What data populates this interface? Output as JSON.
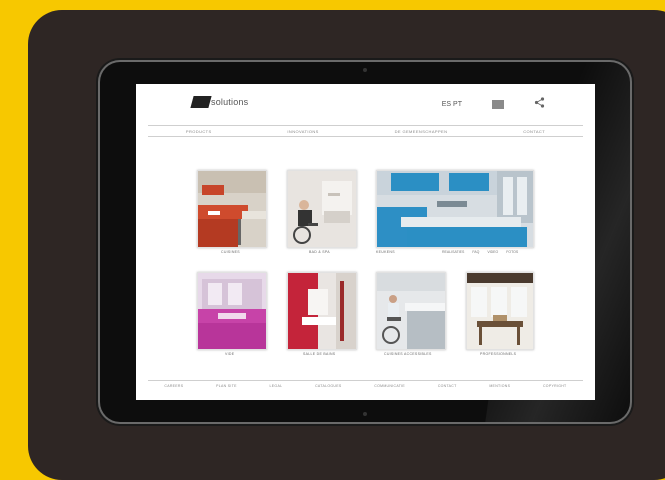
{
  "app": {
    "logo_text": "solutions",
    "header_icons": [
      "language-icon",
      "menu-icon",
      "share-icon"
    ],
    "language_label": "ES PT",
    "colors": {
      "background": "#f7c800",
      "panel": "#2e2624",
      "screen": "#ffffff",
      "blue_kitchen": "#2b8fc4"
    }
  },
  "nav": {
    "items": [
      "PRODUCTS",
      "INNOVATIONS",
      "DE GEMEENSCHAPPEN",
      "CONTACT"
    ]
  },
  "gallery": {
    "tiles": [
      {
        "caption": "CUISINES"
      },
      {
        "caption": "BAD & SPA"
      },
      {
        "caption": "KEUKENS",
        "links": [
          "REALISATIES",
          "FAQ",
          "VIDEO",
          "FOTOS"
        ]
      },
      {
        "caption": "VIDE"
      },
      {
        "caption": "SALLE DE BAINS"
      },
      {
        "caption": "CUISINES ACCESSIBLES"
      },
      {
        "caption": "PROFESSIONNELS"
      }
    ]
  },
  "footer": {
    "items": [
      "CAREERS",
      "PLAN SITE",
      "LEGAL",
      "CATALOGUES",
      "COMMUNICATIE",
      "CONTACT",
      "MENTIONS",
      "COPYRIGHT"
    ]
  }
}
